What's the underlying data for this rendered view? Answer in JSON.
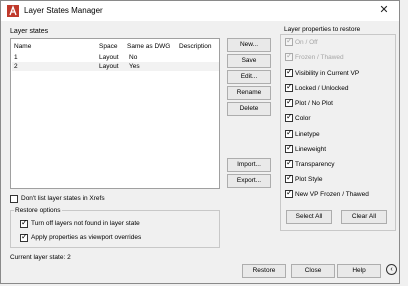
{
  "window": {
    "title": "Layer States Manager"
  },
  "layer_states": {
    "section_label": "Layer states",
    "columns": [
      "Name",
      "Space",
      "Same as DWG",
      "Description"
    ],
    "rows": [
      {
        "name": "1",
        "space": "Layout",
        "same": "No",
        "desc": ""
      },
      {
        "name": "2",
        "space": "Layout",
        "same": "Yes",
        "desc": ""
      }
    ]
  },
  "buttons": {
    "new": "New...",
    "save": "Save",
    "edit": "Edit...",
    "rename": "Rename",
    "delete": "Delete",
    "import": "Import...",
    "export": "Export..."
  },
  "xrefs_option": {
    "label": "Don't list layer states in Xrefs",
    "checked": false
  },
  "restore_options": {
    "label": "Restore options",
    "turn_off": {
      "label": "Turn off layers not found in layer state",
      "checked": true
    },
    "apply_viewport": {
      "label": "Apply properties as viewport overrides",
      "checked": true
    }
  },
  "current_state": "Current layer state: 2",
  "properties": {
    "label": "Layer properties to restore",
    "items": [
      {
        "label": "On / Off",
        "checked": true,
        "disabled": true
      },
      {
        "label": "Frozen / Thawed",
        "checked": true,
        "disabled": true
      },
      {
        "label": "Visibility in Current VP",
        "checked": true,
        "disabled": false
      },
      {
        "label": "Locked / Unlocked",
        "checked": true,
        "disabled": false
      },
      {
        "label": "Plot / No Plot",
        "checked": true,
        "disabled": false
      },
      {
        "label": "Color",
        "checked": true,
        "disabled": false
      },
      {
        "label": "Linetype",
        "checked": true,
        "disabled": false
      },
      {
        "label": "Lineweight",
        "checked": true,
        "disabled": false
      },
      {
        "label": "Transparency",
        "checked": true,
        "disabled": false
      },
      {
        "label": "Plot Style",
        "checked": true,
        "disabled": false
      },
      {
        "label": "New VP Frozen / Thawed",
        "checked": true,
        "disabled": false
      }
    ],
    "select_all": "Select All",
    "clear_all": "Clear All"
  },
  "footer": {
    "restore": "Restore",
    "close": "Close",
    "help": "Help",
    "collapse_glyph": "‹"
  }
}
